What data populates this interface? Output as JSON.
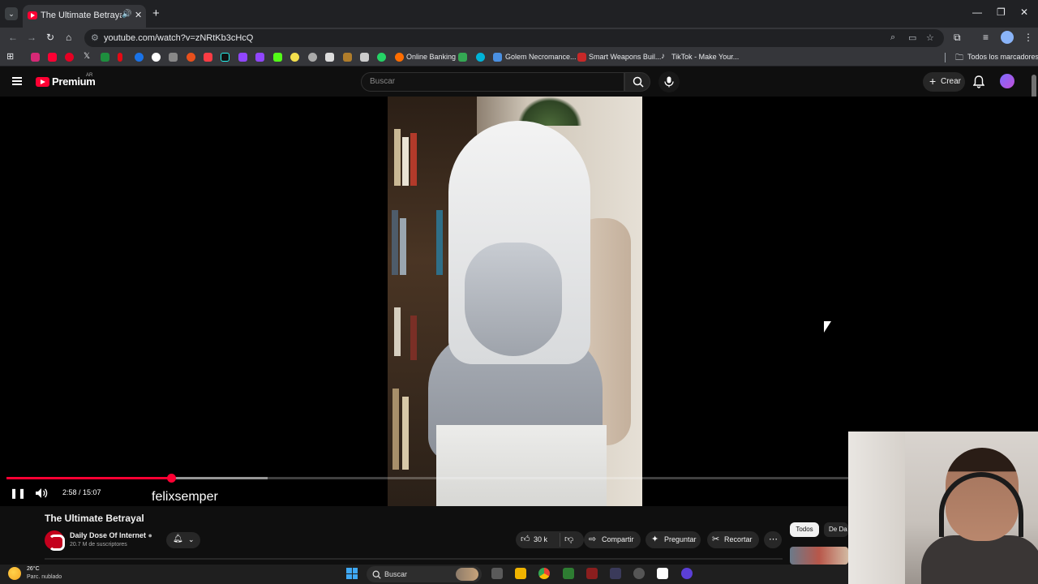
{
  "browser": {
    "tab_title": "The Ultimate Betrayal - You",
    "url": "youtube.com/watch?v=zNRtKb3cHcQ",
    "bookmarks": [
      {
        "label": "Online Banking",
        "icon": "banking-icon",
        "color": "#ff6d00"
      },
      {
        "label": "Golem Necromance...",
        "icon": "golem-icon",
        "color": "#4a90e2"
      },
      {
        "label": "Smart Weapons Buil...",
        "icon": "weapons-icon",
        "color": "#c62828"
      },
      {
        "label": "TikTok - Make Your...",
        "icon": "tiktok-icon",
        "color": "#ffffff"
      }
    ],
    "all_bookmarks": "Todos los marcadores"
  },
  "youtube": {
    "brand": "Premium",
    "country": "AR",
    "search_placeholder": "Buscar",
    "create_label": "Crear"
  },
  "player": {
    "current_time": "2:58",
    "duration": "15:07",
    "time_display": "2:58 / 15:07",
    "played_fraction": 0.196,
    "buffered_fraction": 0.31,
    "watermark": "felixsemper"
  },
  "video": {
    "title": "The Ultimate Betrayal",
    "channel": "Daily Dose Of Internet",
    "subscribers": "20.7 M de suscriptores",
    "likes": "30 k",
    "share_label": "Compartir",
    "ask_label": "Preguntar",
    "clip_label": "Recortar"
  },
  "chips": [
    "Todos",
    "De Da"
  ],
  "taskbar": {
    "temperature": "26°C",
    "condition": "Parc. nublado",
    "search": "Buscar"
  },
  "colors": {
    "accent": "#ff0033",
    "background": "#0f0f0f"
  }
}
